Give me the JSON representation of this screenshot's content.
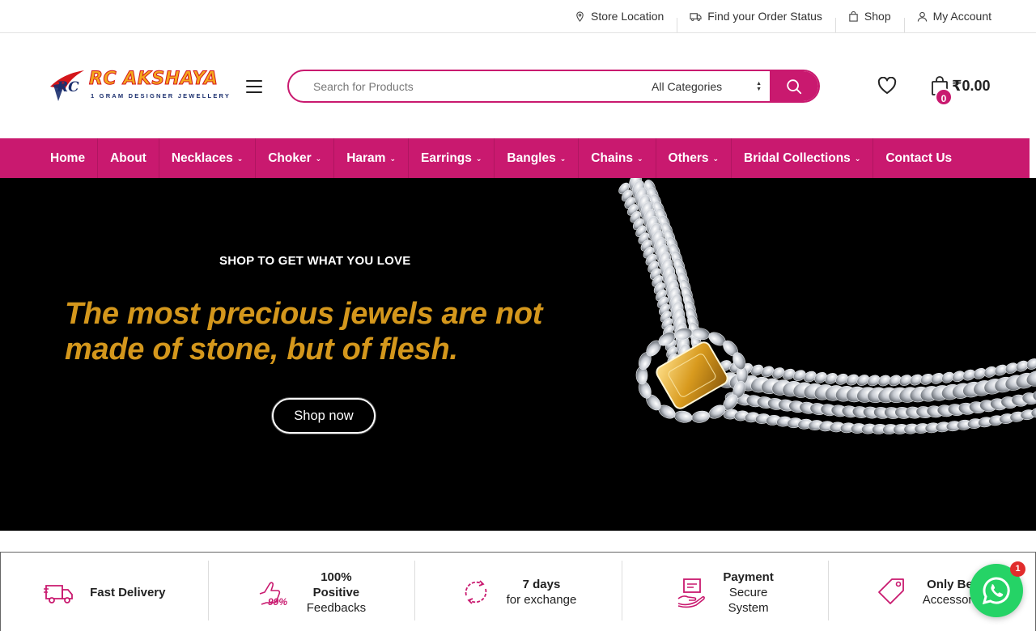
{
  "topbar": {
    "links": [
      {
        "label": "Store Location",
        "icon": "map-pin-icon"
      },
      {
        "label": "Find your Order Status",
        "icon": "truck-icon"
      },
      {
        "label": "Shop",
        "icon": "shopping-bag-icon"
      },
      {
        "label": "My Account",
        "icon": "user-icon"
      }
    ]
  },
  "header": {
    "logo_mark": "RC",
    "logo_brand": "RC AKSHAYA",
    "logo_tagline": "1 GRAM DESIGNER JEWELLERY",
    "search_placeholder": "Search for Products",
    "search_category": "All Categories",
    "cart_count": "0",
    "cart_total": "₹0.00"
  },
  "nav": {
    "items": [
      {
        "label": "Home",
        "dropdown": false
      },
      {
        "label": "About",
        "dropdown": false
      },
      {
        "label": "Necklaces",
        "dropdown": true
      },
      {
        "label": "Choker",
        "dropdown": true
      },
      {
        "label": "Haram",
        "dropdown": true
      },
      {
        "label": "Earrings",
        "dropdown": true
      },
      {
        "label": "Bangles",
        "dropdown": true
      },
      {
        "label": "Chains",
        "dropdown": true
      },
      {
        "label": "Others",
        "dropdown": true
      },
      {
        "label": "Bridal Collections",
        "dropdown": true
      },
      {
        "label": "Contact Us",
        "dropdown": false
      }
    ]
  },
  "hero": {
    "kicker": "SHOP TO GET WHAT YOU LOVE",
    "title": "The most precious jewels are not made of stone, but of flesh.",
    "button": "Shop now"
  },
  "features": [
    {
      "icon": "delivery-truck-icon",
      "line1": "Fast Delivery",
      "line2": ""
    },
    {
      "icon": "thumbs-up-99-icon",
      "line1": "100% Positive",
      "line2": "Feedbacks",
      "icon_text": "99%"
    },
    {
      "icon": "exchange-icon",
      "line1": "7 days",
      "line2": "for exchange"
    },
    {
      "icon": "secure-payment-icon",
      "line1": "Payment",
      "line2": "Secure System"
    },
    {
      "icon": "price-tag-icon",
      "line1": "Only Best",
      "line2": "Accessories"
    }
  ],
  "whatsapp": {
    "badge": "1"
  },
  "colors": {
    "accent": "#c9196f",
    "gold": "#d4971c",
    "hero_bg": "#000000",
    "whatsapp": "#25d366"
  }
}
